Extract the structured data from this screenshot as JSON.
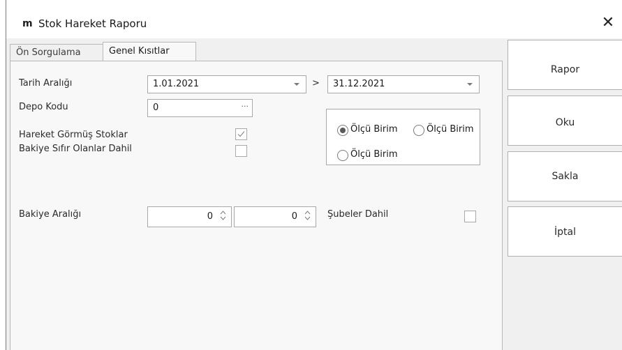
{
  "window": {
    "app_icon_text": "m",
    "title": "Stok Hareket Raporu",
    "close_glyph": "✕"
  },
  "tabs": [
    {
      "label": "Ön Sorgulama",
      "active": false
    },
    {
      "label": "Genel Kısıtlar",
      "active": true
    }
  ],
  "form": {
    "date_range_label": "Tarih Aralığı",
    "date_from": "1.01.2021",
    "date_separator": ">",
    "date_to": "31.12.2021",
    "depot_label": "Depo Kodu",
    "depot_value": "0",
    "depot_ellipsis": "···",
    "moved_stocks_label": "Hareket Görmüş Stoklar",
    "moved_stocks_checked": true,
    "zero_balance_label": "Bakiye Sıfır Olanlar Dahil",
    "zero_balance_checked": false,
    "balance_range_label": "Bakiye Aralığı",
    "balance_from": "0",
    "balance_to": "0",
    "branches_label": "Şubeler Dahil",
    "branches_checked": false
  },
  "unit_options": [
    {
      "label": "Ölçü Birim",
      "selected": true
    },
    {
      "label": "Ölçü Birim",
      "selected": false
    },
    {
      "label": "Ölçü Birim",
      "selected": false
    }
  ],
  "actions": {
    "report": "Rapor",
    "read": "Oku",
    "save": "Sakla",
    "cancel": "İptal"
  },
  "icons": {
    "dropdown": "chevron-down-icon",
    "checkmark": "check-icon",
    "spinner": "spin-arrows-icon"
  }
}
